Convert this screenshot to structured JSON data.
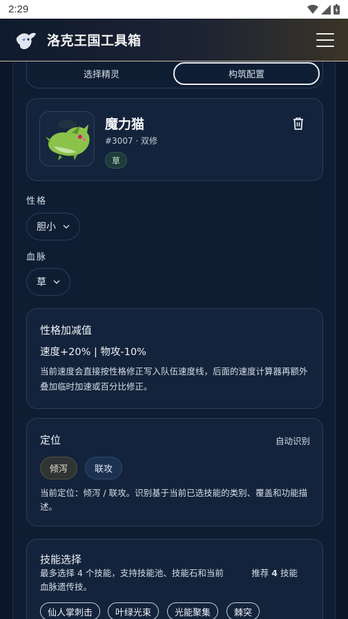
{
  "status": {
    "time": "2:29"
  },
  "app": {
    "title": "洛克王国工具箱"
  },
  "tabs": [
    {
      "label": "选择精灵",
      "active": false
    },
    {
      "label": "构筑配置",
      "active": true
    }
  ],
  "spirit": {
    "name": "魔力猫",
    "meta": "#3007 · 双修",
    "type": "草"
  },
  "nature": {
    "label": "性格",
    "value": "胆小"
  },
  "bloodline": {
    "label": "血脉",
    "value": "草"
  },
  "nature_effect": {
    "title": "性格加减值",
    "value": "速度+20% | 物攻-10%",
    "description": "当前速度会直接按性格修正写入队伍速度线，后面的速度计算器再额外叠加临时加速或百分比修正。"
  },
  "role": {
    "title": "定位",
    "auto_label": "自动识别",
    "tags": [
      "倾泻",
      "联攻"
    ],
    "description": "当前定位：倾泻 / 联攻。识别基于当前已选技能的类别、覆盖和功能描述。"
  },
  "skills": {
    "title": "技能选择",
    "description": "最多选择 4 个技能，支持技能池、技能石和当前血脉遗传技。",
    "recommend_label": "推荐",
    "recommend_count": "4",
    "recommend_suffix": "技能",
    "items": [
      "仙人掌刺击",
      "叶绿光束",
      "光能聚集",
      "棘突"
    ]
  },
  "colors": {
    "background": "#0b1628",
    "card": "#13233b",
    "border": "#2c3d57"
  }
}
